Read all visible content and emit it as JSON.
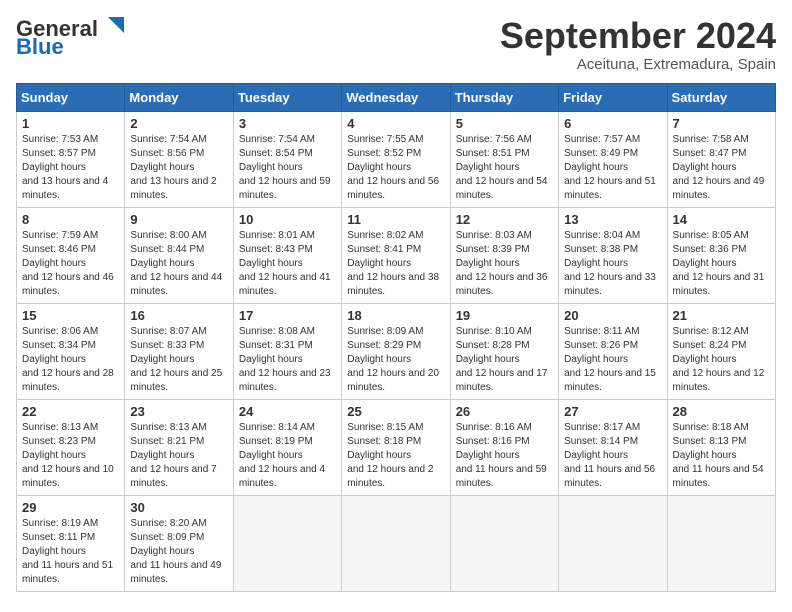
{
  "header": {
    "logo_general": "General",
    "logo_blue": "Blue",
    "month_title": "September 2024",
    "subtitle": "Aceituna, Extremadura, Spain"
  },
  "weekdays": [
    "Sunday",
    "Monday",
    "Tuesday",
    "Wednesday",
    "Thursday",
    "Friday",
    "Saturday"
  ],
  "weeks": [
    [
      {
        "day": 1,
        "sunrise": "7:53 AM",
        "sunset": "8:57 PM",
        "daylight": "13 hours and 4 minutes."
      },
      {
        "day": 2,
        "sunrise": "7:54 AM",
        "sunset": "8:56 PM",
        "daylight": "13 hours and 2 minutes."
      },
      {
        "day": 3,
        "sunrise": "7:54 AM",
        "sunset": "8:54 PM",
        "daylight": "12 hours and 59 minutes."
      },
      {
        "day": 4,
        "sunrise": "7:55 AM",
        "sunset": "8:52 PM",
        "daylight": "12 hours and 56 minutes."
      },
      {
        "day": 5,
        "sunrise": "7:56 AM",
        "sunset": "8:51 PM",
        "daylight": "12 hours and 54 minutes."
      },
      {
        "day": 6,
        "sunrise": "7:57 AM",
        "sunset": "8:49 PM",
        "daylight": "12 hours and 51 minutes."
      },
      {
        "day": 7,
        "sunrise": "7:58 AM",
        "sunset": "8:47 PM",
        "daylight": "12 hours and 49 minutes."
      }
    ],
    [
      {
        "day": 8,
        "sunrise": "7:59 AM",
        "sunset": "8:46 PM",
        "daylight": "12 hours and 46 minutes."
      },
      {
        "day": 9,
        "sunrise": "8:00 AM",
        "sunset": "8:44 PM",
        "daylight": "12 hours and 44 minutes."
      },
      {
        "day": 10,
        "sunrise": "8:01 AM",
        "sunset": "8:43 PM",
        "daylight": "12 hours and 41 minutes."
      },
      {
        "day": 11,
        "sunrise": "8:02 AM",
        "sunset": "8:41 PM",
        "daylight": "12 hours and 38 minutes."
      },
      {
        "day": 12,
        "sunrise": "8:03 AM",
        "sunset": "8:39 PM",
        "daylight": "12 hours and 36 minutes."
      },
      {
        "day": 13,
        "sunrise": "8:04 AM",
        "sunset": "8:38 PM",
        "daylight": "12 hours and 33 minutes."
      },
      {
        "day": 14,
        "sunrise": "8:05 AM",
        "sunset": "8:36 PM",
        "daylight": "12 hours and 31 minutes."
      }
    ],
    [
      {
        "day": 15,
        "sunrise": "8:06 AM",
        "sunset": "8:34 PM",
        "daylight": "12 hours and 28 minutes."
      },
      {
        "day": 16,
        "sunrise": "8:07 AM",
        "sunset": "8:33 PM",
        "daylight": "12 hours and 25 minutes."
      },
      {
        "day": 17,
        "sunrise": "8:08 AM",
        "sunset": "8:31 PM",
        "daylight": "12 hours and 23 minutes."
      },
      {
        "day": 18,
        "sunrise": "8:09 AM",
        "sunset": "8:29 PM",
        "daylight": "12 hours and 20 minutes."
      },
      {
        "day": 19,
        "sunrise": "8:10 AM",
        "sunset": "8:28 PM",
        "daylight": "12 hours and 17 minutes."
      },
      {
        "day": 20,
        "sunrise": "8:11 AM",
        "sunset": "8:26 PM",
        "daylight": "12 hours and 15 minutes."
      },
      {
        "day": 21,
        "sunrise": "8:12 AM",
        "sunset": "8:24 PM",
        "daylight": "12 hours and 12 minutes."
      }
    ],
    [
      {
        "day": 22,
        "sunrise": "8:13 AM",
        "sunset": "8:23 PM",
        "daylight": "12 hours and 10 minutes."
      },
      {
        "day": 23,
        "sunrise": "8:13 AM",
        "sunset": "8:21 PM",
        "daylight": "12 hours and 7 minutes."
      },
      {
        "day": 24,
        "sunrise": "8:14 AM",
        "sunset": "8:19 PM",
        "daylight": "12 hours and 4 minutes."
      },
      {
        "day": 25,
        "sunrise": "8:15 AM",
        "sunset": "8:18 PM",
        "daylight": "12 hours and 2 minutes."
      },
      {
        "day": 26,
        "sunrise": "8:16 AM",
        "sunset": "8:16 PM",
        "daylight": "11 hours and 59 minutes."
      },
      {
        "day": 27,
        "sunrise": "8:17 AM",
        "sunset": "8:14 PM",
        "daylight": "11 hours and 56 minutes."
      },
      {
        "day": 28,
        "sunrise": "8:18 AM",
        "sunset": "8:13 PM",
        "daylight": "11 hours and 54 minutes."
      }
    ],
    [
      {
        "day": 29,
        "sunrise": "8:19 AM",
        "sunset": "8:11 PM",
        "daylight": "11 hours and 51 minutes."
      },
      {
        "day": 30,
        "sunrise": "8:20 AM",
        "sunset": "8:09 PM",
        "daylight": "11 hours and 49 minutes."
      },
      null,
      null,
      null,
      null,
      null
    ]
  ]
}
